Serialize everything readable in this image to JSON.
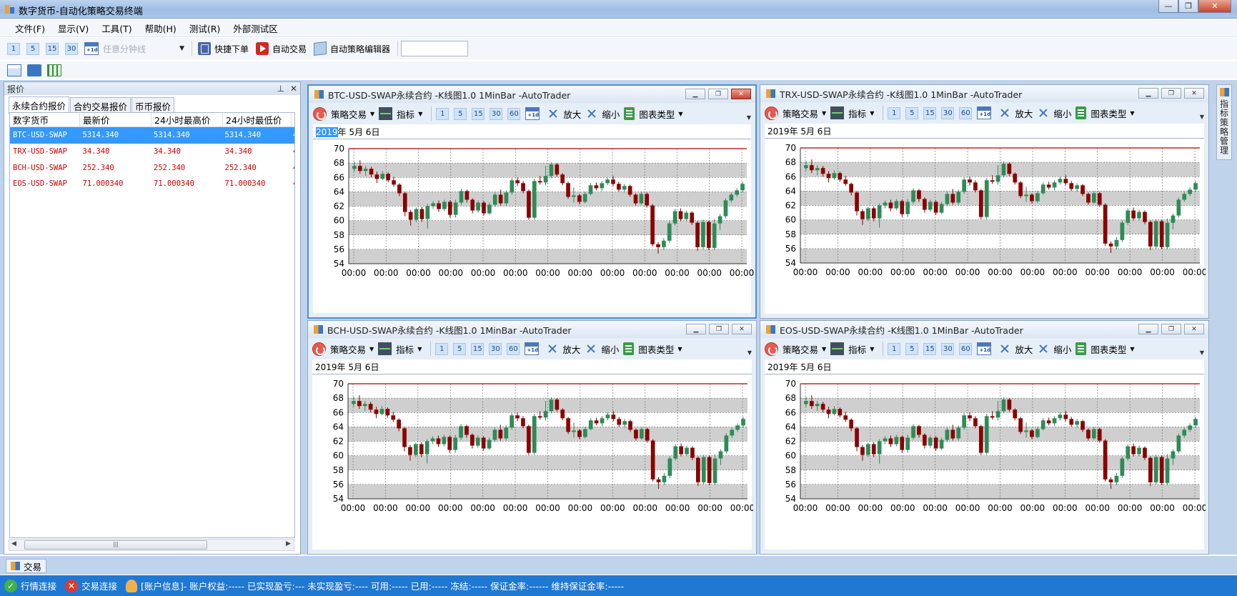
{
  "window": {
    "title": "数字货币-自动化策略交易终端"
  },
  "menu": [
    "文件(F)",
    "显示(V)",
    "工具(T)",
    "帮助(H)",
    "测试(R)",
    "外部测试区"
  ],
  "toolbar": {
    "intervals": [
      "1",
      "5",
      "15",
      "30"
    ],
    "calendar_label": "+1d",
    "custom_interval_placeholder": "任意分钟线",
    "quick_order": "快捷下单",
    "auto_trade": "自动交易",
    "strategy_editor": "自动策略编辑器"
  },
  "quote_panel": {
    "title": "报价",
    "pin": "ᴥ",
    "close": "✕",
    "tabs": [
      "永续合约报价",
      "合约交易报价",
      "币币报价"
    ],
    "columns": [
      "数字货币",
      "最新价",
      "24小时最高价",
      "24小时最低价"
    ],
    "rows": [
      {
        "symbol": "BTC-USD-SWAP",
        "last": "5314.340",
        "high": "5314.340",
        "low": "5314.340",
        "more": "4"
      },
      {
        "symbol": "TRX-USD-SWAP",
        "last": "34.340",
        "high": "34.340",
        "low": "34.340",
        "more": "4"
      },
      {
        "symbol": "BCH-USD-SWAP",
        "last": "252.340",
        "high": "252.340",
        "low": "252.340",
        "more": "4"
      },
      {
        "symbol": "EOS-USD-SWAP",
        "last": "71.000340",
        "high": "71.000340",
        "low": "71.000340",
        "more": "4"
      }
    ],
    "selected_row": 0
  },
  "chart_toolbar": {
    "strategy": "策略交易",
    "indicator": "指标",
    "intervals": [
      "1",
      "5",
      "15",
      "30",
      "60"
    ],
    "calendar_label": "+1d",
    "zoom_in": "放大",
    "zoom_out": "缩小",
    "chart_type": "图表类型"
  },
  "charts": [
    {
      "title": "BTC-USD-SWAP永续合约 -K线图1.0 1MinBar -AutoTrader",
      "date": "2019年  5月  6日",
      "date_sel": "2019",
      "date_rest": "年  5月  6日",
      "active": true
    },
    {
      "title": "TRX-USD-SWAP永续合约 -K线图1.0 1MinBar -AutoTrader",
      "date": "2019年  5月  6日",
      "active": false
    },
    {
      "title": "BCH-USD-SWAP永续合约 -K线图1.0 1MinBar -AutoTrader",
      "date": "2019年  5月  6日",
      "active": false
    },
    {
      "title": "EOS-USD-SWAP永续合约 -K线图1.0 1MinBar -AutoTrader",
      "date": "2019年  5月  6日",
      "active": false
    }
  ],
  "chart_data": {
    "type": "candlestick",
    "y_ticks": [
      70,
      68,
      66,
      64,
      62,
      60,
      58,
      56,
      54
    ],
    "ylim": [
      54,
      70
    ],
    "x_tick_label": "00:00",
    "x_tick_count": 13,
    "up_color": "#2e8b57",
    "down_color": "#8b0000",
    "resistance_color": "#b00000",
    "candles": [
      [
        67.2,
        67.6,
        68.2,
        66.8
      ],
      [
        67.6,
        66.9,
        68.4,
        66.5
      ],
      [
        66.9,
        67.2,
        67.6,
        66.2
      ],
      [
        67.2,
        66.4,
        67.5,
        66.0
      ],
      [
        66.4,
        65.8,
        66.8,
        65.2
      ],
      [
        65.8,
        66.5,
        66.9,
        65.6
      ],
      [
        66.5,
        65.6,
        66.7,
        65.3
      ],
      [
        65.6,
        65.0,
        66.1,
        64.7
      ],
      [
        65.0,
        63.8,
        65.2,
        63.4
      ],
      [
        63.8,
        61.2,
        64.0,
        60.6
      ],
      [
        61.2,
        60.1,
        61.5,
        59.3
      ],
      [
        60.1,
        61.6,
        61.8,
        59.8
      ],
      [
        61.6,
        60.2,
        61.9,
        59.8
      ],
      [
        60.2,
        62.0,
        62.3,
        58.9
      ],
      [
        62.0,
        62.4,
        62.7,
        61.6
      ],
      [
        62.4,
        61.6,
        62.8,
        61.2
      ],
      [
        61.6,
        62.6,
        62.9,
        61.3
      ],
      [
        62.6,
        60.8,
        62.8,
        60.4
      ],
      [
        60.8,
        62.5,
        62.9,
        60.4
      ],
      [
        62.5,
        64.1,
        64.4,
        62.2
      ],
      [
        64.1,
        62.9,
        64.3,
        62.5
      ],
      [
        62.9,
        61.4,
        63.1,
        61.0
      ],
      [
        61.4,
        62.5,
        62.8,
        61.1
      ],
      [
        62.5,
        61.0,
        62.7,
        60.7
      ],
      [
        61.0,
        62.2,
        62.5,
        60.8
      ],
      [
        62.2,
        63.6,
        63.9,
        61.9
      ],
      [
        63.6,
        62.4,
        64.3,
        62.1
      ],
      [
        62.4,
        63.9,
        64.2,
        62.1
      ],
      [
        63.9,
        65.6,
        65.9,
        63.6
      ],
      [
        65.6,
        65.2,
        66.0,
        64.8
      ],
      [
        65.2,
        64.1,
        65.5,
        63.8
      ],
      [
        64.1,
        60.4,
        64.3,
        60.1
      ],
      [
        60.4,
        65.5,
        65.8,
        60.1
      ],
      [
        65.5,
        65.3,
        66.2,
        65.0
      ],
      [
        65.3,
        66.2,
        67.6,
        64.9
      ],
      [
        66.2,
        67.8,
        68.1,
        65.9
      ],
      [
        67.8,
        66.4,
        68.0,
        66.1
      ],
      [
        66.4,
        65.2,
        66.6,
        64.9
      ],
      [
        65.2,
        63.3,
        65.4,
        63.0
      ],
      [
        63.3,
        63.5,
        64.6,
        62.5
      ],
      [
        63.5,
        62.6,
        63.7,
        62.3
      ],
      [
        62.6,
        63.7,
        64.0,
        62.4
      ],
      [
        63.7,
        64.9,
        65.2,
        63.5
      ],
      [
        64.9,
        64.5,
        65.3,
        64.2
      ],
      [
        64.5,
        65.2,
        65.5,
        64.1
      ],
      [
        65.2,
        65.7,
        66.0,
        64.9
      ],
      [
        65.7,
        65.1,
        66.2,
        64.8
      ],
      [
        65.1,
        64.3,
        65.4,
        64.0
      ],
      [
        64.3,
        64.8,
        65.1,
        63.9
      ],
      [
        64.8,
        63.6,
        65.0,
        63.3
      ],
      [
        63.6,
        62.4,
        63.8,
        62.1
      ],
      [
        62.4,
        63.7,
        64.0,
        62.2
      ],
      [
        63.7,
        62.1,
        63.9,
        61.8
      ],
      [
        62.1,
        56.7,
        62.3,
        56.4
      ],
      [
        56.7,
        56.3,
        57.0,
        55.4
      ],
      [
        56.3,
        57.2,
        57.6,
        55.9
      ],
      [
        57.2,
        59.6,
        59.9,
        56.9
      ],
      [
        59.6,
        61.3,
        61.6,
        59.3
      ],
      [
        61.3,
        60.2,
        61.7,
        59.9
      ],
      [
        60.2,
        61.1,
        61.4,
        59.9
      ],
      [
        61.1,
        59.7,
        61.3,
        59.4
      ],
      [
        59.7,
        56.3,
        59.9,
        55.8
      ],
      [
        56.3,
        59.8,
        60.1,
        56.0
      ],
      [
        59.8,
        56.2,
        60.0,
        55.9
      ],
      [
        56.2,
        59.6,
        60.2,
        55.9
      ],
      [
        59.6,
        60.6,
        60.9,
        58.7
      ],
      [
        60.6,
        62.8,
        63.1,
        60.3
      ],
      [
        62.8,
        63.6,
        63.9,
        62.5
      ],
      [
        63.6,
        64.2,
        64.5,
        63.3
      ],
      [
        64.2,
        65.1,
        65.4,
        63.9
      ]
    ]
  },
  "side_panel": "指标策略管理",
  "bottom_tab": "交易",
  "status": {
    "market": "行情连接",
    "trade": "交易连接",
    "account": "[账户信息]- 账户权益:-----   已实现盈亏:---   未实现盈亏:----  可用:-----  已用:-----  冻结:-----   保证金率:------  维持保证金率:-----"
  }
}
